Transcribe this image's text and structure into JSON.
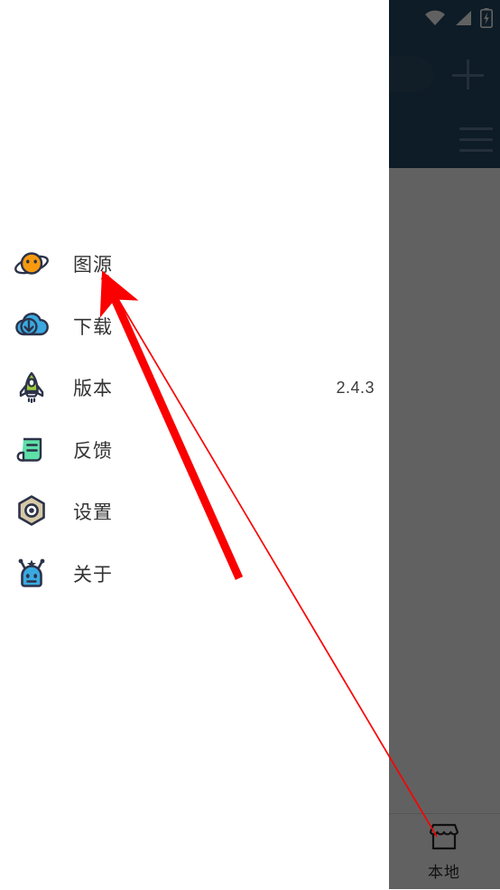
{
  "status_bar": {
    "icons": [
      "wifi-icon",
      "signal-icon",
      "battery-charging-icon"
    ]
  },
  "app": {
    "header": {
      "color": "#234a68",
      "search_placeholder": "",
      "add_button_label": "+",
      "menu_button_label": "menu"
    },
    "bottom_nav": {
      "items": [
        {
          "icon": "store-icon",
          "label": "本地"
        }
      ]
    }
  },
  "drawer": {
    "background": "#ffffff",
    "items": [
      {
        "icon": "planet-icon",
        "label": "图源",
        "value": ""
      },
      {
        "icon": "cloud-download-icon",
        "label": "下载",
        "value": ""
      },
      {
        "icon": "rocket-icon",
        "label": "版本",
        "value": "2.4.3"
      },
      {
        "icon": "feedback-icon",
        "label": "反馈",
        "value": ""
      },
      {
        "icon": "settings-nut-icon",
        "label": "设置",
        "value": ""
      },
      {
        "icon": "robot-icon",
        "label": "关于",
        "value": ""
      }
    ]
  },
  "annotation": {
    "color": "#fa0000",
    "type": "arrow",
    "points_to": "图源"
  }
}
